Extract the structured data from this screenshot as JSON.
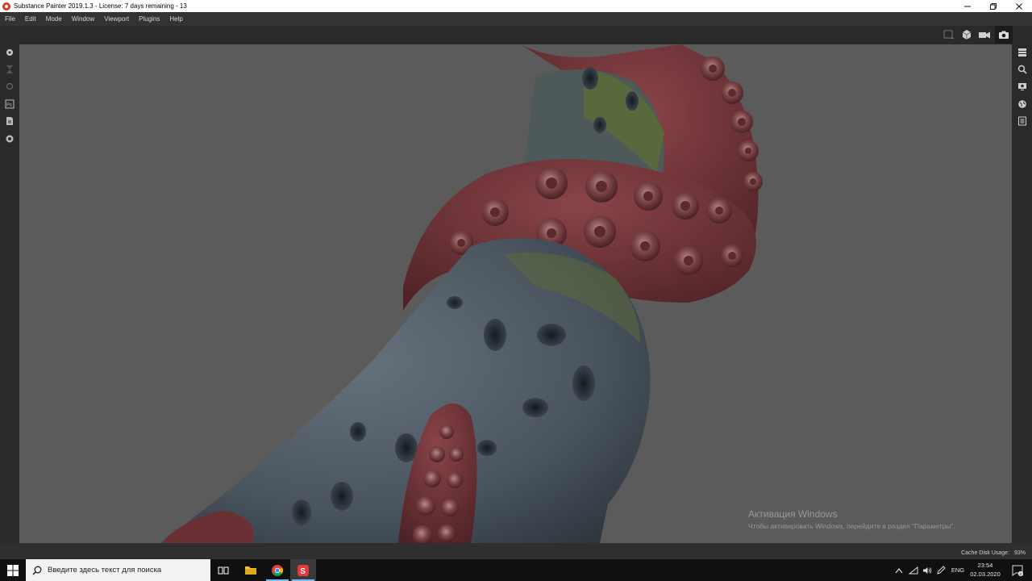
{
  "window": {
    "title": "Substance Painter 2019.1.3 - License: 7 days remaining - 13",
    "controls": [
      "minimize",
      "restore",
      "close"
    ]
  },
  "menu": [
    "File",
    "Edit",
    "Mode",
    "Window",
    "Viewport",
    "Plugins",
    "Help"
  ],
  "viewport_toolbar": [
    "frame-icon",
    "cube-icon",
    "camera-video-icon",
    "screenshot-icon"
  ],
  "left_toolbar": [
    "brush-icon",
    "hourglass-icon",
    "sphere-icon",
    "photoshop-icon",
    "document-icon",
    "settings-icon"
  ],
  "right_toolbar": [
    "layers-icon",
    "zoom-icon",
    "display-icon",
    "globe-icon",
    "properties-icon"
  ],
  "watermark": {
    "line1": "Активация Windows",
    "line2": "Чтобы активировать Windows, перейдите в раздел \"Параметры\"."
  },
  "status": {
    "cache_label": "Cache Disk Usage:",
    "cache_value": "93%"
  },
  "taskbar": {
    "search_placeholder": "Введите здесь текст для поиска",
    "apps": [
      "task-view-icon",
      "file-explorer-icon",
      "chrome-icon",
      "substance-painter-icon"
    ],
    "tray_lang": "ENG",
    "time": "23:54",
    "date": "02.03.2020",
    "notifications": "2"
  },
  "colors": {
    "viewport_bg": "#5b5b5b",
    "panel_bg": "#2a2a2a",
    "taskbar_bg": "#101010",
    "tentacle": "#7a3a3e",
    "rock": "#4b5763",
    "moss": "#5d6a38"
  }
}
